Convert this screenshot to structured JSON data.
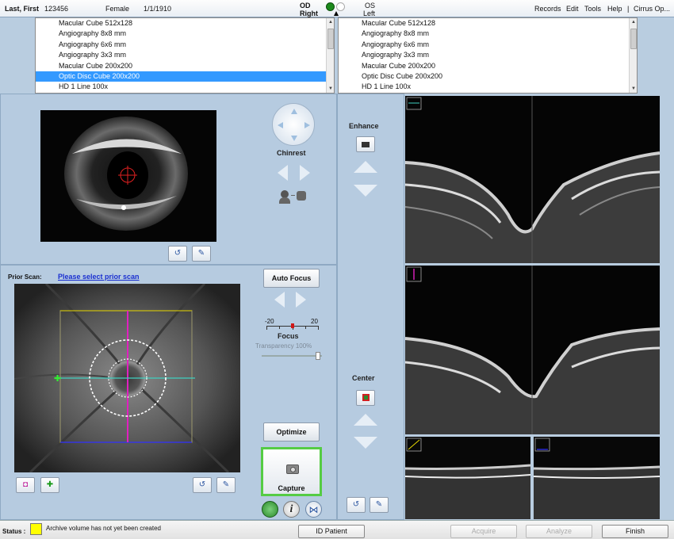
{
  "patient": {
    "name": "Last, First",
    "id": "123456",
    "sex": "Female",
    "dob": "1/1/1910"
  },
  "eye": {
    "od_label": "OD",
    "od_sub": "Right",
    "os_label": "OS",
    "os_sub": "Left"
  },
  "menu": [
    "Records",
    "Edit",
    "Tools",
    "Help",
    "|",
    "Cirrus Op..."
  ],
  "protocols_od": {
    "items": [
      "Macular Cube 512x128",
      "Angiography 8x8 mm",
      "Angiography 6x6 mm",
      "Angiography 3x3 mm",
      "Macular Cube 200x200",
      "Optic Disc Cube 200x200",
      "HD 1 Line 100x"
    ],
    "selected": "Optic Disc Cube 200x200"
  },
  "protocols_os": {
    "items": [
      "Macular Cube 512x128",
      "Angiography 8x8 mm",
      "Angiography 6x6 mm",
      "Angiography 3x3 mm",
      "Macular Cube 200x200",
      "Optic Disc Cube 200x200",
      "HD 1 Line 100x"
    ]
  },
  "chinrest": {
    "label": "Chinrest"
  },
  "prior_scan": {
    "label": "Prior Scan:",
    "link": "Please select prior scan"
  },
  "focus": {
    "auto_focus": "Auto Focus",
    "min": "-20",
    "max": "20",
    "label": "Focus",
    "transparency": "Transparency 100%",
    "transparency_value": 100
  },
  "buttons": {
    "optimize": "Optimize",
    "capture": "Capture",
    "id_patient": "ID Patient",
    "acquire": "Acquire",
    "analyze": "Analyze",
    "finish": "Finish"
  },
  "enhance": {
    "label": "Enhance"
  },
  "center": {
    "label": "Center"
  },
  "status": {
    "label": "Status :",
    "message": "Archive volume has not yet been created",
    "color": "#ffff00"
  },
  "colors": {
    "selected": "#3399ff",
    "capture_border": "#55cc44",
    "line_yellow": "#e8d800",
    "line_cyan": "#3fd0c0",
    "line_magenta": "#e020c0",
    "line_blue": "#3030ff",
    "target_red": "#e02020"
  }
}
